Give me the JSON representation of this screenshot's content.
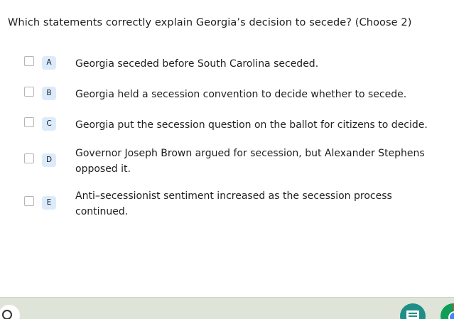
{
  "question": {
    "text": "Which statements correctly explain Georgia’s decision to secede?  (Choose 2)"
  },
  "options": [
    {
      "letter": "A",
      "text": "Georgia seceded before South Carolina seceded."
    },
    {
      "letter": "B",
      "text": "Georgia held a secession convention to decide whether to secede."
    },
    {
      "letter": "C",
      "text": "Georgia put the secession question on the ballot for citizens to decide."
    },
    {
      "letter": "D",
      "text": "Governor Joseph Brown argued for secession, but Alexander Stephens opposed it."
    },
    {
      "letter": "E",
      "text": "Anti–secessionist sentiment increased as the secession process continued."
    }
  ],
  "taskbar": {
    "icons": [
      "launcher-icon",
      "classroom-app-icon",
      "chrome-icon"
    ]
  },
  "colors": {
    "letter_badge_bg": "#dcebfb",
    "taskbar_bg": "#dfe4d8"
  }
}
